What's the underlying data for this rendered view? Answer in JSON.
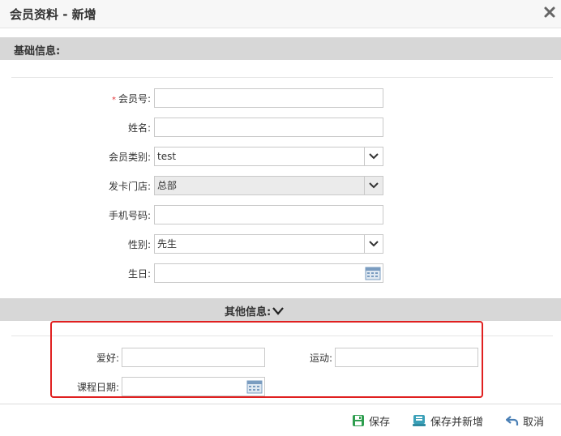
{
  "dialog": {
    "title": "会员资料 - 新增"
  },
  "basic_section": {
    "title": "基础信息:",
    "fields": {
      "member_no": {
        "required_mark": "*",
        "label": "会员号:",
        "value": ""
      },
      "name": {
        "label": "姓名:",
        "value": ""
      },
      "member_type": {
        "label": "会员类别:",
        "value": "test"
      },
      "card_store": {
        "label": "发卡门店:",
        "value": "总部"
      },
      "mobile": {
        "label": "手机号码:",
        "value": ""
      },
      "gender": {
        "label": "性别:",
        "value": "先生"
      },
      "birthday": {
        "label": "生日:",
        "value": ""
      }
    }
  },
  "other_section": {
    "title": "其他信息:",
    "fields": {
      "hobby": {
        "label": "爱好:",
        "value": ""
      },
      "sport": {
        "label": "运动:",
        "value": ""
      },
      "course_date": {
        "label": "课程日期:",
        "value": ""
      }
    }
  },
  "footer": {
    "save": "保存",
    "save_and_new": "保存并新增",
    "cancel": "取消"
  },
  "colors": {
    "section_bg": "#d7d7d7",
    "highlight_border": "#e02020",
    "required": "#e4393c",
    "icon_green": "#2e9e4f",
    "icon_teal": "#3aa0b8",
    "icon_blue": "#4a7fb5"
  },
  "icons": [
    "close-icon",
    "chevron-down-icon",
    "calendar-icon",
    "save-icon",
    "save-and-new-icon",
    "undo-icon"
  ]
}
